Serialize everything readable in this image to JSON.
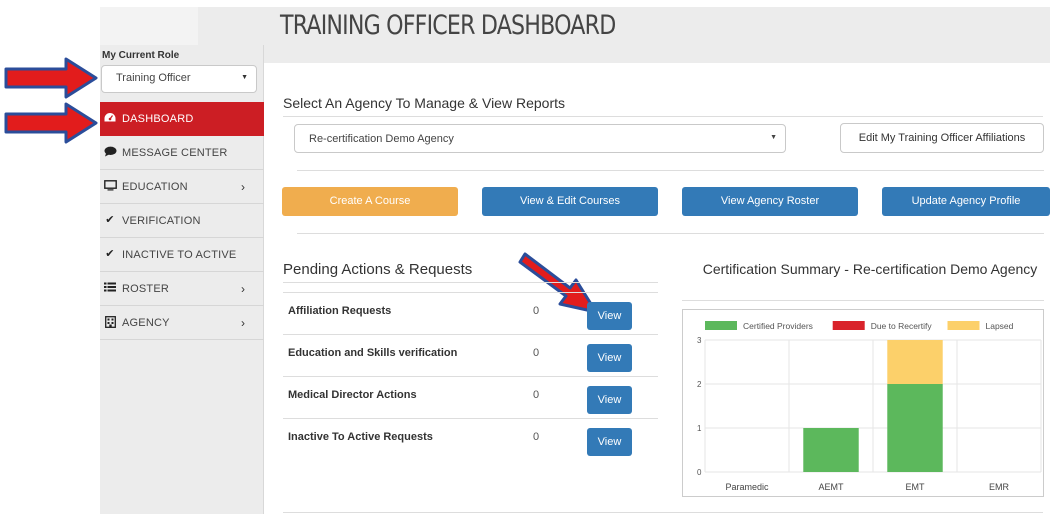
{
  "page": {
    "title": "TRAINING OFFICER DASHBOARD"
  },
  "sidebar": {
    "role_label": "My Current Role",
    "role_value": "Training Officer",
    "items": [
      {
        "label": "DASHBOARD",
        "icon": "dashboard-icon",
        "active": true,
        "chevron": false
      },
      {
        "label": "MESSAGE CENTER",
        "icon": "comment-icon",
        "active": false,
        "chevron": false
      },
      {
        "label": "EDUCATION",
        "icon": "monitor-icon",
        "active": false,
        "chevron": true
      },
      {
        "label": "VERIFICATION",
        "icon": "check-icon",
        "active": false,
        "chevron": false
      },
      {
        "label": "INACTIVE TO ACTIVE",
        "icon": "check-icon",
        "active": false,
        "chevron": false
      },
      {
        "label": "ROSTER",
        "icon": "list-icon",
        "active": false,
        "chevron": true
      },
      {
        "label": "AGENCY",
        "icon": "building-icon",
        "active": false,
        "chevron": true
      }
    ],
    "chevron": "›"
  },
  "agency": {
    "section_title": "Select An Agency To Manage & View Reports",
    "selected": "Re-certification Demo Agency",
    "edit_button": "Edit My Training Officer Affiliations"
  },
  "actions": {
    "create_course": "Create A Course",
    "view_edit_courses": "View & Edit Courses",
    "view_roster": "View Agency Roster",
    "update_profile": "Update Agency Profile"
  },
  "pending": {
    "title": "Pending Actions & Requests",
    "view_label": "View",
    "rows": [
      {
        "name": "Affiliation Requests",
        "count": "0"
      },
      {
        "name": "Education and Skills verification",
        "count": "0"
      },
      {
        "name": "Medical Director Actions",
        "count": "0"
      },
      {
        "name": "Inactive To Active Requests",
        "count": "0"
      }
    ]
  },
  "colors": {
    "sidebar_active": "#cc1e24",
    "primary_button": "#337ab7",
    "warning_button": "#f0ad4e",
    "annotation_arrow": "#e21c1c"
  },
  "chart_data": {
    "type": "bar",
    "title": "Certification Summary - Re-certification Demo Agency",
    "categories": [
      "Paramedic",
      "AEMT",
      "EMT",
      "EMR"
    ],
    "series": [
      {
        "name": "Certified Providers",
        "color": "#5cb85c",
        "values": [
          0,
          1,
          2,
          0
        ]
      },
      {
        "name": "Due to Recertify",
        "color": "#d9232b",
        "values": [
          0,
          0,
          0,
          0
        ]
      },
      {
        "name": "Lapsed",
        "color": "#fcd06a",
        "values": [
          0,
          0,
          1,
          0
        ]
      }
    ],
    "stacked": true,
    "ylim": [
      0,
      3
    ],
    "yticks": [
      "0",
      "1",
      "2",
      "3"
    ],
    "grid": true,
    "legend": "top"
  }
}
